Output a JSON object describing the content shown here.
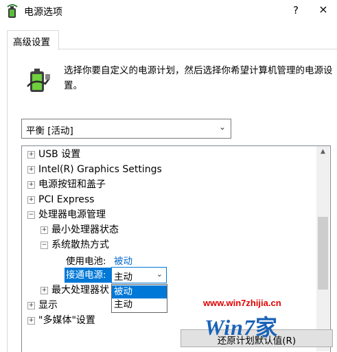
{
  "window": {
    "title": "电源选项",
    "help": "?",
    "close": "×"
  },
  "tab": {
    "label": "高级设置"
  },
  "description": "选择你要自定义的电源计划，然后选择你希望计算机管理的电源设置。",
  "plan_select": {
    "value": "平衡 [活动]"
  },
  "tree": {
    "items": [
      {
        "sign": "+",
        "label": "USB 设置"
      },
      {
        "sign": "+",
        "label": "Intel(R) Graphics Settings"
      },
      {
        "sign": "+",
        "label": "电源按钮和盖子"
      },
      {
        "sign": "+",
        "label": "PCI Express"
      },
      {
        "sign": "−",
        "label": "处理器电源管理"
      },
      {
        "sign": "+",
        "label": "最小处理器状态"
      },
      {
        "sign": "−",
        "label": "系统散热方式"
      },
      {
        "sign": "+",
        "label": "最大处理器状"
      },
      {
        "sign": "+",
        "label": "显示"
      },
      {
        "sign": "+",
        "label": "\"多媒体\"设置"
      }
    ],
    "on_battery_label": "使用电池:",
    "on_battery_value": "被动",
    "plugged_in_label": "接通电源:",
    "plugged_in_value": "主动",
    "options": [
      "被动",
      "主动"
    ]
  },
  "restore_button": "还原计划默认值(R)",
  "watermark": {
    "url": "www.win7zhijia.cn",
    "logo": "Win7",
    "logo_suffix": "家"
  },
  "colors": {
    "accent": "#0078d7",
    "link": "#0066cc",
    "watermark_red": "#e00000",
    "watermark_blue": "#1a63b8"
  }
}
